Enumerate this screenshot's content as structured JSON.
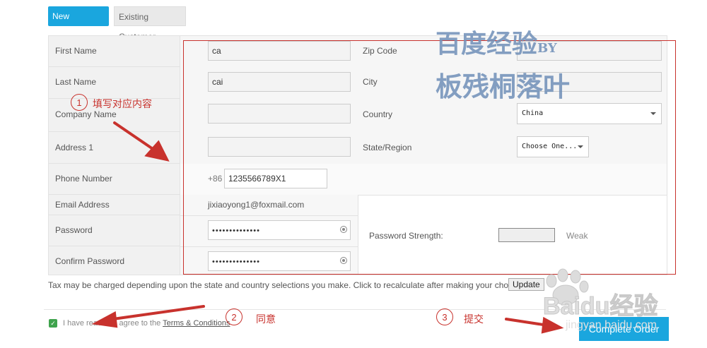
{
  "tabs": {
    "new_customer": "New Customer",
    "existing_customer": "Existing Customer"
  },
  "form": {
    "first_name_label": "First Name",
    "first_name_value": "ca",
    "last_name_label": "Last Name",
    "last_name_value": "cai",
    "company_name_label": "Company Name",
    "company_name_value": "",
    "address1_label": "Address 1",
    "address1_value": "",
    "phone_label": "Phone Number",
    "phone_prefix": "+86",
    "phone_value": "1235566789X1",
    "email_label": "Email Address",
    "email_value": "jixiaoyong1@foxmail.com",
    "password_label": "Password",
    "password_value": "••••••••••••••",
    "confirm_password_label": "Confirm Password",
    "confirm_password_value": "••••••••••••••",
    "zip_label": "Zip Code",
    "zip_value": "",
    "city_label": "City",
    "city_value": "",
    "country_label": "Country",
    "country_value": "China",
    "state_label": "State/Region",
    "state_value": "Choose One...",
    "strength_label": "Password Strength:",
    "strength_text": "Weak"
  },
  "tax_note": "Tax may be charged depending upon the state and country selections you make. Click to recalculate after making your choices.",
  "update_button": "Update",
  "agree": {
    "prefix": "I have read and agree to the ",
    "link": "Terms & Conditions"
  },
  "complete_button": "Complete Order",
  "annotations": {
    "n1": "1",
    "note1": "填写对应内容",
    "n2": "2",
    "note2": "同意",
    "n3": "3",
    "note3": "提交"
  },
  "watermark": {
    "line1": "百度经验",
    "line1_suffix": "BY",
    "line2": "板残桐落叶",
    "baidu_text": "Baidu经验",
    "baidu_url": "jingyan.baidu.com"
  },
  "colors": {
    "accent": "#1aa6de",
    "annotation_red": "#c8322d",
    "check_green": "#3fa34d"
  }
}
